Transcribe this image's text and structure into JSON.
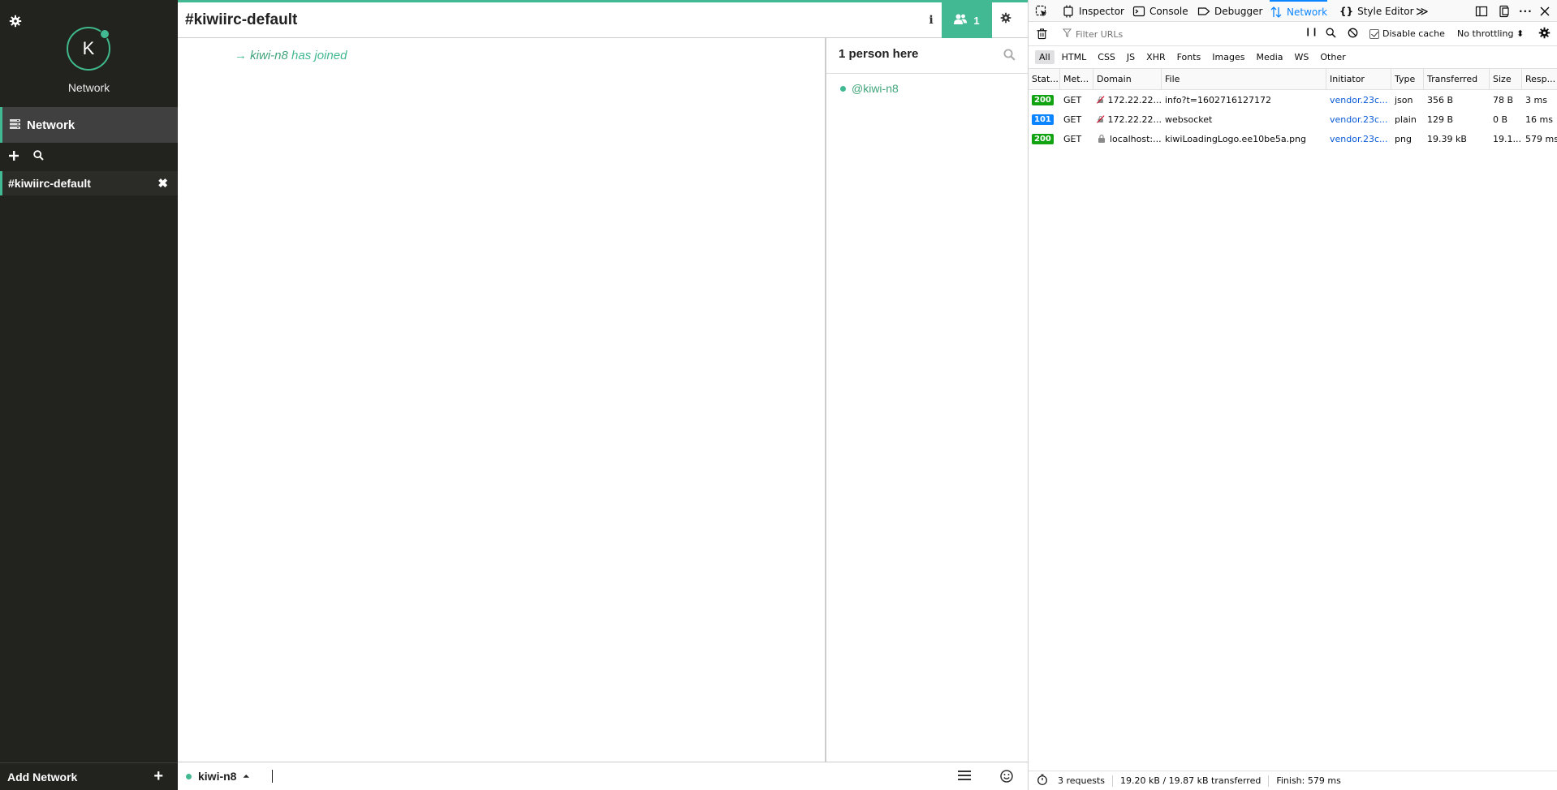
{
  "kiwi": {
    "sidebar": {
      "avatar_letter": "K",
      "network_name": "Network",
      "network_item_label": "Network",
      "channel_label": "#kiwiirc-default",
      "channel_close": "✖",
      "add_network_label": "Add Network",
      "add_network_plus": "+"
    },
    "header": {
      "channel_title": "#kiwiirc-default",
      "info_label": "i",
      "user_count": "1"
    },
    "messages": {
      "join_arrow": "→",
      "join_nick": "kiwi-n8",
      "join_text": " has joined"
    },
    "nicklist": {
      "count_text": "1 person here",
      "users": [
        {
          "nick": "@kiwi-n8"
        }
      ]
    },
    "input": {
      "nick": "kiwi-n8",
      "nick_caret": "⏶"
    },
    "colors": {
      "accent": "#42b992",
      "sidebar_bg": "#22231e"
    }
  },
  "devtools": {
    "tabs": [
      {
        "label": "Inspector"
      },
      {
        "label": "Console"
      },
      {
        "label": "Debugger"
      },
      {
        "label": "Network"
      },
      {
        "label": "Style Editor"
      }
    ],
    "more_tabs": "≫",
    "toolbar": {
      "filter_placeholder": "Filter URLs",
      "pause_label": "❙❙",
      "disable_cache_label": "Disable cache",
      "throttling_label": "No throttling ⬍"
    },
    "type_filters": [
      "All",
      "HTML",
      "CSS",
      "JS",
      "XHR",
      "Fonts",
      "Images",
      "Media",
      "WS",
      "Other"
    ],
    "columns": [
      "Stat...",
      "Met...",
      "Domain",
      "File",
      "Initiator",
      "Type",
      "Transferred",
      "Size",
      "Resp..."
    ],
    "requests": [
      {
        "status": "200",
        "status_color": "#12a312",
        "method": "GET",
        "domain": "172.22.22...",
        "domain_icon": "insecure-icon",
        "file": "info?t=1602716127172",
        "initiator": "vendor.23c...",
        "type": "json",
        "transferred": "356 B",
        "size": "78 B",
        "response": "3 ms"
      },
      {
        "status": "101",
        "status_color": "#0a84ff",
        "method": "GET",
        "domain": "172.22.22...",
        "domain_icon": "insecure-icon",
        "file": "websocket",
        "initiator": "vendor.23c...",
        "type": "plain",
        "transferred": "129 B",
        "size": "0 B",
        "response": "16 ms"
      },
      {
        "status": "200",
        "status_color": "#12a312",
        "method": "GET",
        "domain": "localhost:...",
        "domain_icon": "lock-icon",
        "file": "kiwiLoadingLogo.ee10be5a.png",
        "initiator": "vendor.23c...",
        "type": "png",
        "transferred": "19.39 kB",
        "size": "19.1...",
        "response": "579 ms"
      }
    ],
    "statusbar": {
      "requests": "3 requests",
      "transferred": "19.20 kB / 19.87 kB transferred",
      "finish": "Finish: 579 ms"
    }
  }
}
